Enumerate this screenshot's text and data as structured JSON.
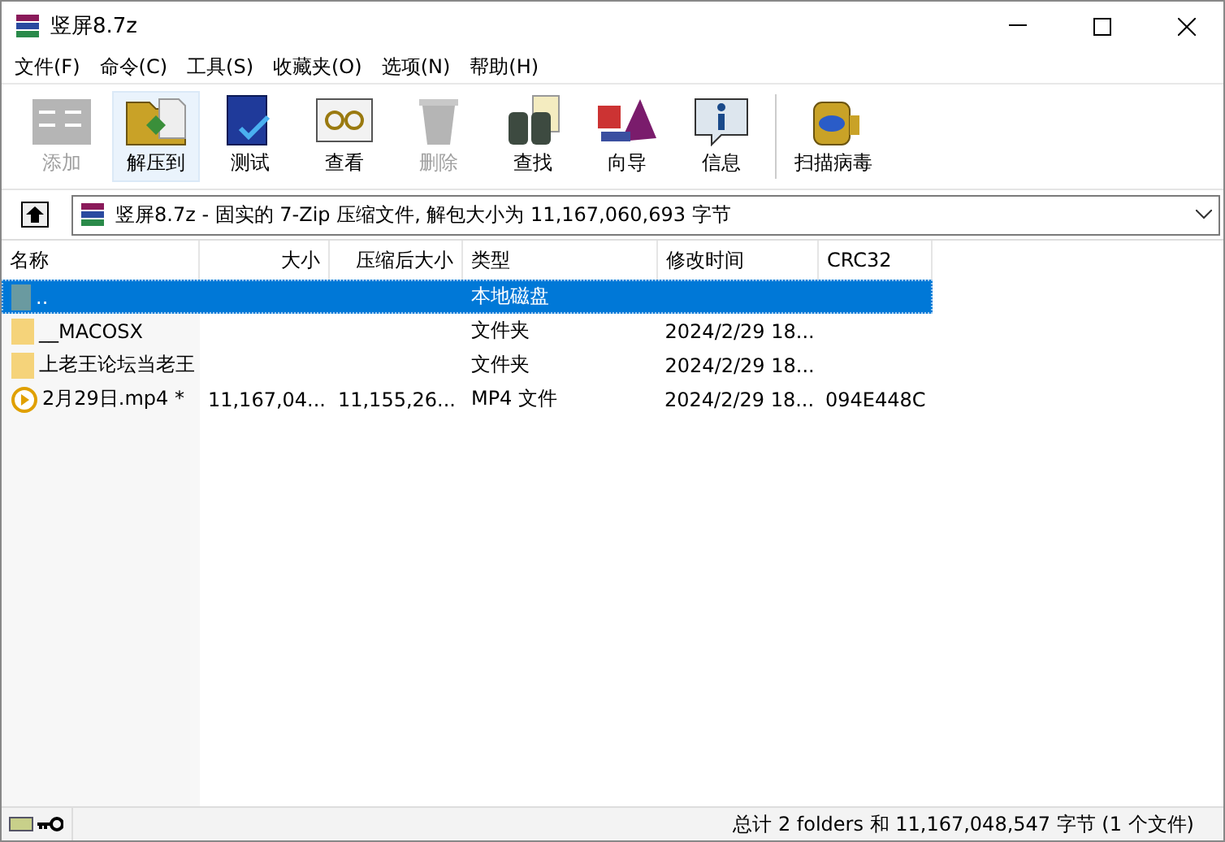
{
  "window": {
    "title": "竖屏8.7z"
  },
  "menu": [
    "文件(F)",
    "命令(C)",
    "工具(S)",
    "收藏夹(O)",
    "选项(N)",
    "帮助(H)"
  ],
  "toolbar": [
    {
      "label": "添加",
      "kind": "add",
      "disabled": true,
      "selected": false
    },
    {
      "label": "解压到",
      "kind": "extract",
      "disabled": false,
      "selected": true
    },
    {
      "label": "测试",
      "kind": "test",
      "disabled": false,
      "selected": false
    },
    {
      "label": "查看",
      "kind": "view",
      "disabled": false,
      "selected": false
    },
    {
      "label": "删除",
      "kind": "delete",
      "disabled": true,
      "selected": false
    },
    {
      "label": "查找",
      "kind": "find",
      "disabled": false,
      "selected": false
    },
    {
      "label": "向导",
      "kind": "wizard",
      "disabled": false,
      "selected": false
    },
    {
      "label": "信息",
      "kind": "info",
      "disabled": false,
      "selected": false
    },
    {
      "label": "扫描病毒",
      "kind": "scan",
      "disabled": false,
      "selected": false
    }
  ],
  "address": "竖屏8.7z - 固实的 7-Zip 压缩文件, 解包大小为 11,167,060,693 字节",
  "table": {
    "columns": [
      "名称",
      "大小",
      "压缩后大小",
      "类型",
      "修改时间",
      "CRC32"
    ],
    "rows": [
      {
        "kind": "up",
        "selected": true,
        "cells": [
          "..",
          "",
          "",
          "本地磁盘",
          "",
          ""
        ]
      },
      {
        "kind": "folder",
        "selected": false,
        "cells": [
          "__MACOSX",
          "",
          "",
          "文件夹",
          "2024/2/29 18...",
          ""
        ]
      },
      {
        "kind": "folder",
        "selected": false,
        "cells": [
          "上老王论坛当老王",
          "",
          "",
          "文件夹",
          "2024/2/29 18...",
          ""
        ]
      },
      {
        "kind": "video",
        "selected": false,
        "cells": [
          "2月29日.mp4 *",
          "11,167,04...",
          "11,155,26...",
          "MP4 文件",
          "2024/2/29 18...",
          "094E448C"
        ]
      }
    ]
  },
  "status_bar": "总计 2 folders 和 11,167,048,547 字节 (1 个文件)"
}
